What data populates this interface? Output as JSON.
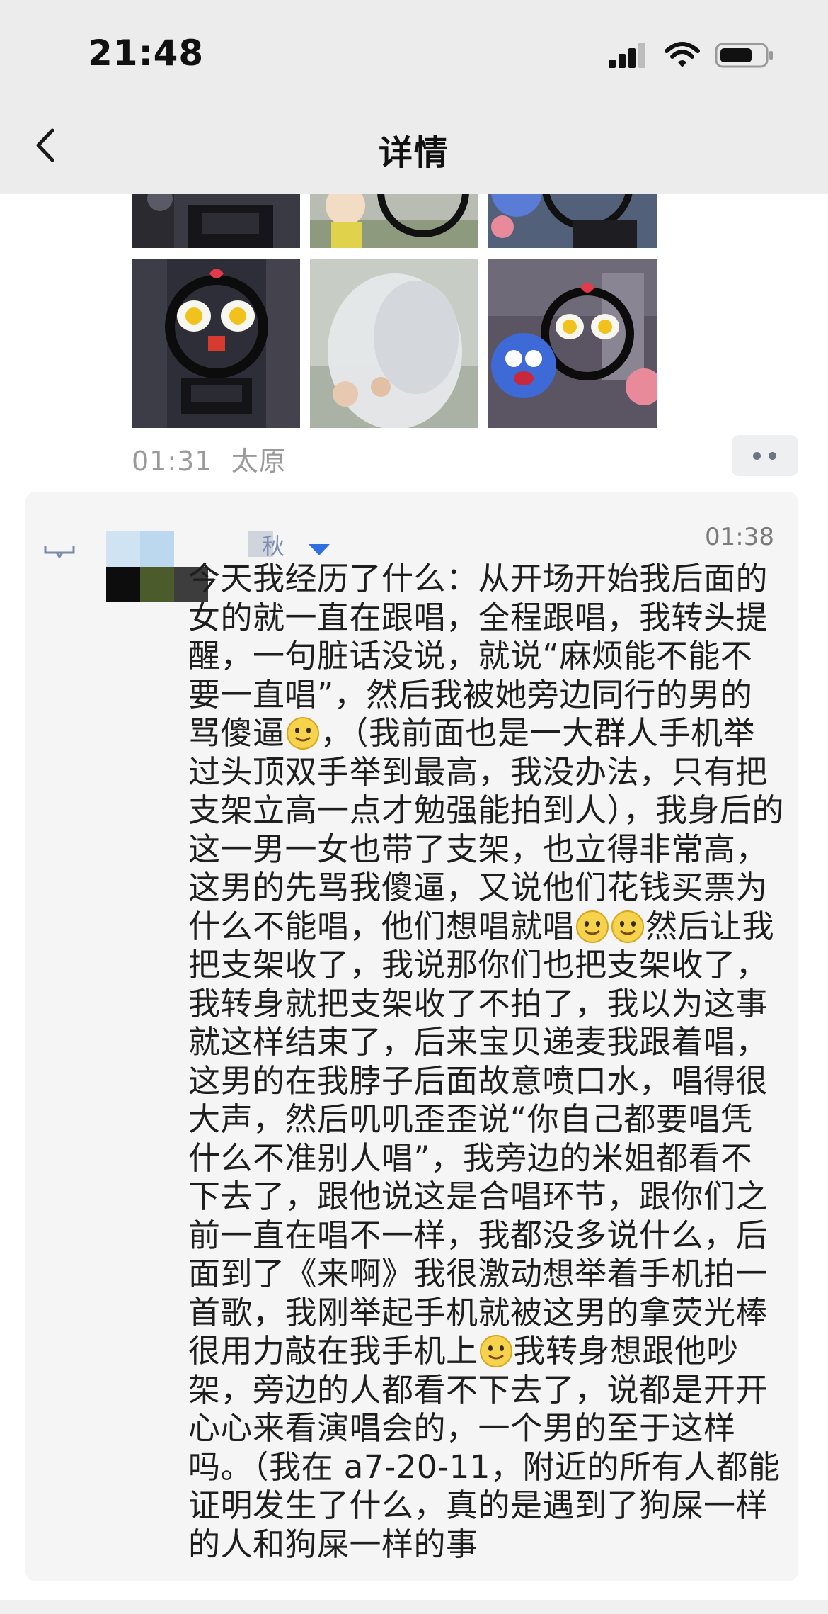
{
  "status_bar": {
    "time": "21:48",
    "icons": [
      "signal-icon",
      "wifi-icon",
      "battery-icon"
    ]
  },
  "header": {
    "title": "详情",
    "back_icon": "chevron-left-icon"
  },
  "post": {
    "photos": [
      "photo-1",
      "photo-2",
      "photo-3",
      "photo-4",
      "photo-5",
      "photo-6"
    ],
    "time": "01:31",
    "location": "太原",
    "more_icon": "more-dots-icon"
  },
  "comment": {
    "author_fragment": "秋",
    "time": "01:38",
    "segments": [
      "今天我经历了什么：从开场开始我后面的女的就一直在跟唱，全程跟唱，我转头提醒，一句脏话没说，就说“麻烦能不能不要一直唱”，然后我被她旁边同行的男的骂傻逼",
      "，（我前面也是一大群人手机举过头顶双手举到最高，我没办法，只有把支架立高一点才勉强能拍到人），我身后的这一男一女也带了支架，也立得非常高，这男的先骂我傻逼，又说他们花钱买票为什么不能唱，他们想唱就唱",
      "然后让我把支架收了，我说那你们也把支架收了，我转身就把支架收了不拍了，我以为这事就这样结束了，后来宝贝递麦我跟着唱，这男的在我脖子后面故意喷口水，唱得很大声，然后叽叽歪歪说“你自己都要唱凭什么不准别人唱”，我旁边的米姐都看不下去了，跟他说这是合唱环节，跟你们之前一直在唱不一样，我都没多说什么，后面到了《来啊》我很激动想举着手机拍一首歌，我刚举起手机就被这男的拿荧光棒很用力敲在我手机上",
      "我转身想跟他吵架，旁边的人都看不下去了，说都是开开心心来看演唱会的，一个男的至于这样吗。（我在 a7-20-11，附近的所有人都能证明发生了什么，真的是遇到了狗屎一样的人和狗屎一样的事"
    ],
    "emoji_icon": "smile-emoji-icon"
  },
  "colors": {
    "header_bg": "#ececec",
    "card_bg": "#f5f5f5",
    "meta_gray": "#9a9a9a",
    "link_blue": "#2f6fe0"
  }
}
